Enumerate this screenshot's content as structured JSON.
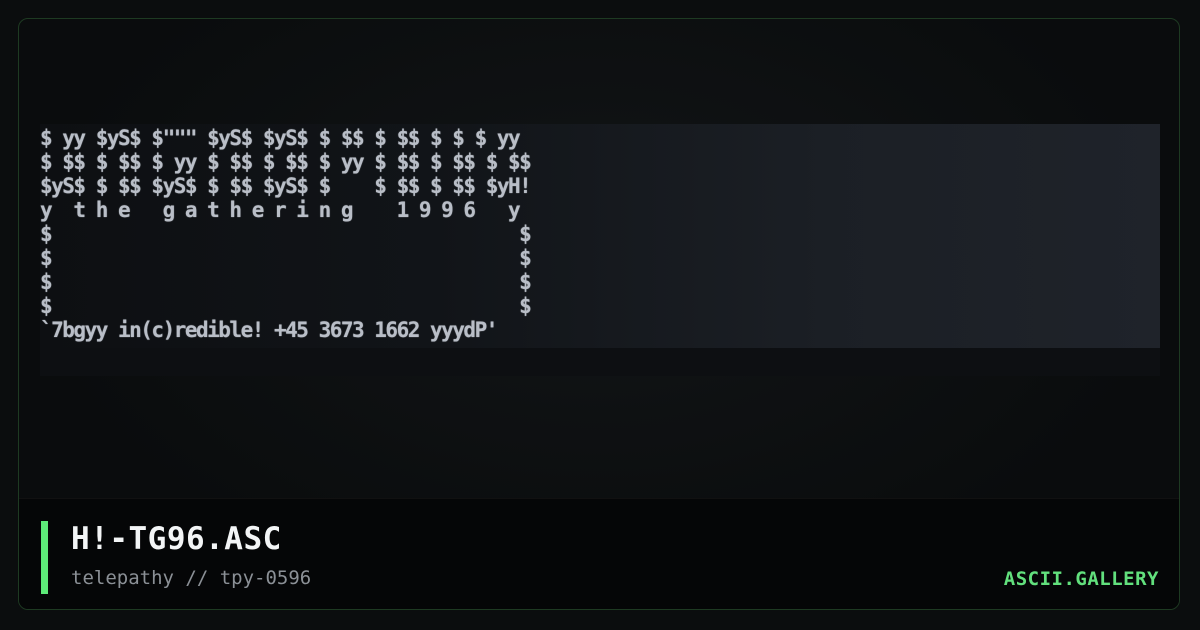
{
  "artwork": {
    "lines": [
      "$ yy $yS$ $\"\"\" $yS$ $yS$ $ $$ $ $$ $ $ $ yy",
      "$ $$ $ $$ $ yy $ $$ $ $$ $ yy $ $$ $ $$ $ $$",
      "$yS$ $ $$ $yS$ $ $$ $yS$ $    $ $$ $ $$ $yH!",
      "y  t h e   g a t h e r i n g    1 9 9 6   y",
      "$                                          $",
      "$                                          $",
      "$                                          $",
      "$                                          $",
      "`7bgyy in(c)redible! +45 3673 1662 yyydP'"
    ]
  },
  "footer": {
    "title": "H!-TG96.ASC",
    "subtitle": "telepathy // tpy-0596",
    "brand": "ASCII.GALLERY"
  },
  "colors": {
    "accent": "#5dea78",
    "brand": "#62e07d",
    "background": "#0b0d0e",
    "ansi_text": "#b9bec7"
  }
}
